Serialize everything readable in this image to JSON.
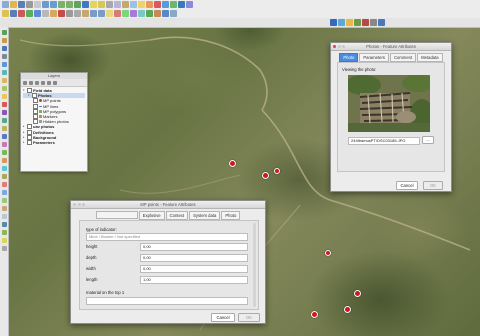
{
  "layers_panel": {
    "title": "Layers",
    "items": [
      {
        "label": "Field data",
        "bold": true
      },
      {
        "label": "Photos",
        "bold": true
      },
      {
        "label": "MP points",
        "bold": false
      },
      {
        "label": "MP lines",
        "bold": false
      },
      {
        "label": "MP polygons",
        "bold": false
      },
      {
        "label": "Markers",
        "bold": false
      },
      {
        "label": "Hidden photos",
        "bold": false
      },
      {
        "label": "uav photos",
        "bold": true
      },
      {
        "label": "Definitions",
        "bold": true
      },
      {
        "label": "Background",
        "bold": true
      },
      {
        "label": "Parameters",
        "bold": true
      }
    ]
  },
  "photo_dialog": {
    "title": "Photos - Feature Attributes",
    "tabs": [
      "Photo",
      "Parameters",
      "Comment",
      "Metadata"
    ],
    "viewing_label": "Viewing the photo:",
    "filename": "244firamusPT/DSC03185.JPG",
    "browse_label": "...",
    "cancel_label": "Cancel",
    "ok_label": "OK"
  },
  "mp_dialog": {
    "title": "MP points - Feature Attributes",
    "tabs": [
      "",
      "Explosive",
      "Context",
      "System data",
      "Photo"
    ],
    "type_label": "type of indicator:",
    "type_value": "Mine / Bunker / Not specified",
    "fields": [
      {
        "label": "height",
        "value": "0,00"
      },
      {
        "label": "depth",
        "value": "0,00"
      },
      {
        "label": "width",
        "value": "0,00"
      },
      {
        "label": "length",
        "value": "1,00"
      }
    ],
    "material_label": "material on the top 1",
    "cancel_label": "Cancel",
    "ok_label": "OK"
  },
  "map": {
    "markers": [
      "marker-1",
      "marker-2",
      "marker-3",
      "marker-4",
      "marker-5",
      "marker-6",
      "marker-7"
    ]
  }
}
